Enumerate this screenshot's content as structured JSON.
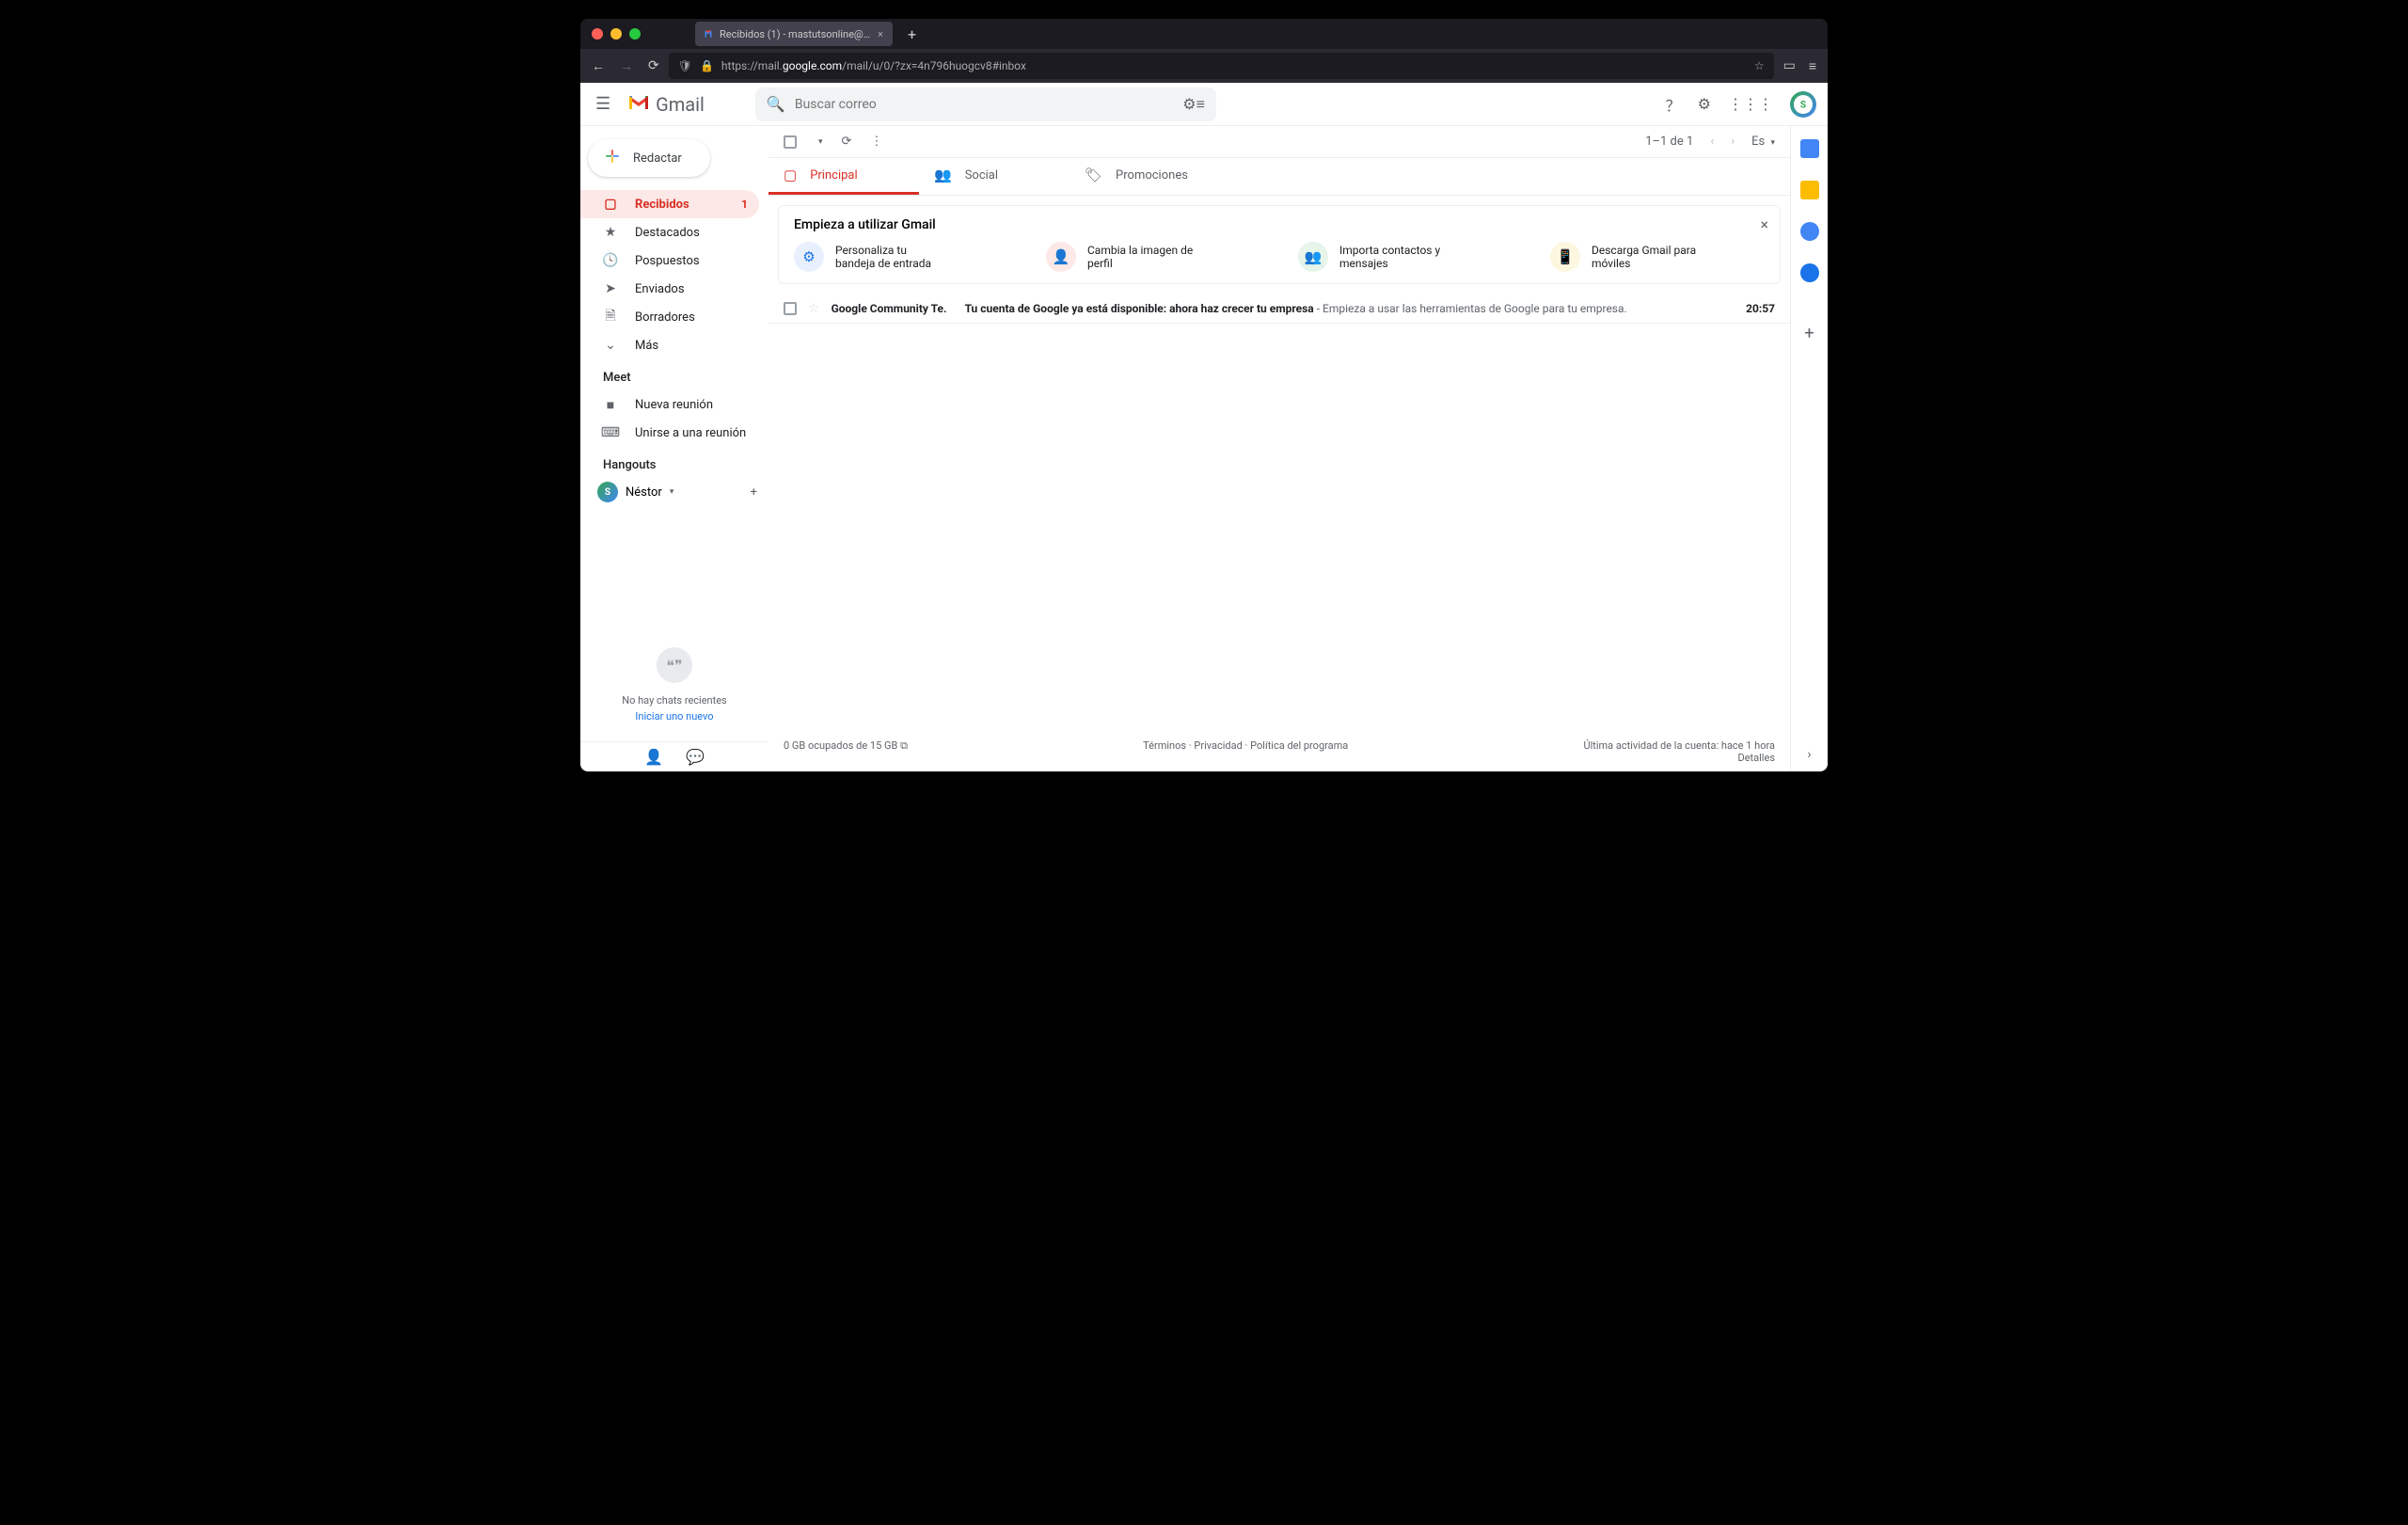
{
  "browser": {
    "tab_title": "Recibidos (1) - mastutsonline@…",
    "url_prefix": "https://mail.",
    "url_domain": "google.com",
    "url_path": "/mail/u/0/?zx=4n796huogcv8#inbox"
  },
  "header": {
    "brand": "Gmail",
    "search_placeholder": "Buscar correo"
  },
  "compose_label": "Redactar",
  "sidebar": {
    "items": [
      {
        "icon": "inbox",
        "label": "Recibidos",
        "count": "1",
        "active": true
      },
      {
        "icon": "star",
        "label": "Destacados"
      },
      {
        "icon": "clock",
        "label": "Pospuestos"
      },
      {
        "icon": "send",
        "label": "Enviados"
      },
      {
        "icon": "file",
        "label": "Borradores"
      },
      {
        "icon": "chevron",
        "label": "Más"
      }
    ],
    "meet_header": "Meet",
    "meet_items": [
      {
        "icon": "video",
        "label": "Nueva reunión"
      },
      {
        "icon": "keyboard",
        "label": "Unirse a una reunión"
      }
    ],
    "hangouts_header": "Hangouts",
    "hangouts_user": "Néstor",
    "no_chats": "No hay chats recientes",
    "start_new": "Iniciar uno nuevo"
  },
  "toolbar": {
    "pagination": "1–1 de 1",
    "lang": "Es"
  },
  "tabs": [
    {
      "label": "Principal",
      "icon": "inbox"
    },
    {
      "label": "Social",
      "icon": "people"
    },
    {
      "label": "Promociones",
      "icon": "tag"
    }
  ],
  "getting_started": {
    "title": "Empieza a utilizar Gmail",
    "items": [
      "Personaliza tu bandeja de entrada",
      "Cambia la imagen de perfil",
      "Importa contactos y mensajes",
      "Descarga Gmail para móviles"
    ]
  },
  "emails": [
    {
      "sender": "Google Community Te.",
      "subject": "Tu cuenta de Google ya está disponible: ahora haz crecer tu empresa",
      "preview": " - Empieza a usar las herramientas de Google para tu empresa.",
      "time": "20:57"
    }
  ],
  "footer": {
    "storage": "0 GB ocupados de 15 GB",
    "terms": "Términos",
    "privacy": "Privacidad",
    "policy": "Política del programa",
    "activity": "Última actividad de la cuenta: hace 1 hora",
    "details": "Detalles"
  }
}
